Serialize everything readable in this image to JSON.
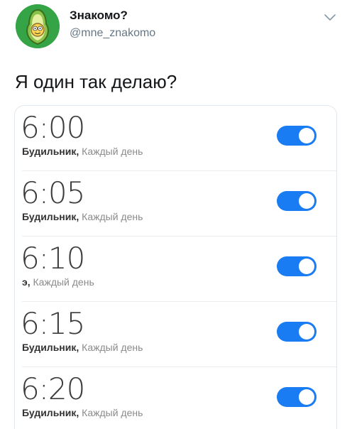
{
  "tweet": {
    "author_name": "Знакомо?",
    "handle": "@mne_znakomo",
    "text": "Я один так делаю?"
  },
  "colors": {
    "toggle_on": "#1a7cf2",
    "handle": "#657786"
  },
  "alarms": [
    {
      "time": "6:00",
      "label": "Будильник,",
      "repeat": "Каждый день",
      "enabled": true
    },
    {
      "time": "6:05",
      "label": "Будильник,",
      "repeat": "Каждый день",
      "enabled": true
    },
    {
      "time": "6:10",
      "label": "э,",
      "repeat": "Каждый день",
      "enabled": true
    },
    {
      "time": "6:15",
      "label": "Будильник,",
      "repeat": "Каждый день",
      "enabled": true
    },
    {
      "time": "6:20",
      "label": "Будильник,",
      "repeat": "Каждый день",
      "enabled": true
    }
  ]
}
